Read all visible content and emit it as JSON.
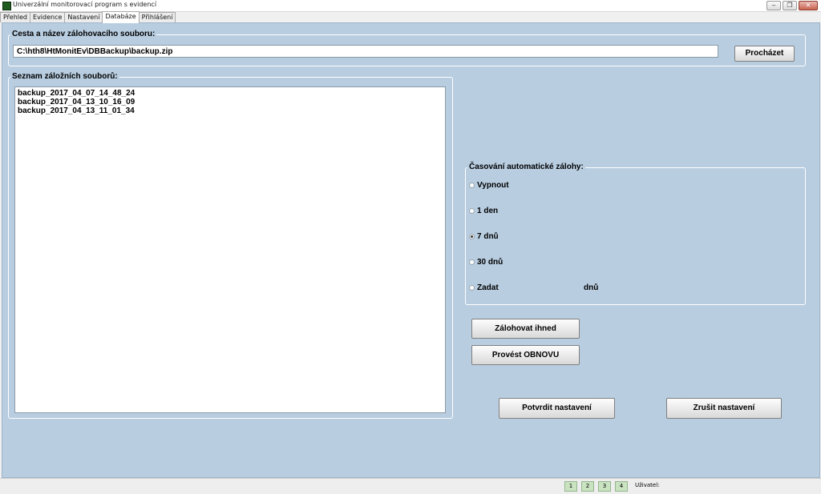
{
  "window": {
    "title": "Univerzální monitorovací program s evidencí",
    "minimize": "‒",
    "maximize": "❐",
    "close": "✕"
  },
  "tabs": [
    {
      "label": "Přehled"
    },
    {
      "label": "Evidence"
    },
    {
      "label": "Nastavení"
    },
    {
      "label": "Databáze"
    },
    {
      "label": "Přihlášení"
    }
  ],
  "backup_path": {
    "label": "Cesta a název zálohovacího souboru:",
    "value": "C:\\hth8\\HtMonitEv\\DBBackup\\backup.zip",
    "browse_label": "Procházet"
  },
  "backup_list": {
    "label": "Seznam záložních souborů:",
    "items": [
      "backup_2017_04_07_14_48_24",
      "backup_2017_04_13_10_16_09",
      "backup_2017_04_13_11_01_34"
    ]
  },
  "auto_backup": {
    "label": "Časování automatické zálohy:",
    "options": [
      {
        "label": "Vypnout",
        "checked": false
      },
      {
        "label": "1 den",
        "checked": false
      },
      {
        "label": "7 dnů",
        "checked": true
      },
      {
        "label": "30 dnů",
        "checked": false
      },
      {
        "label": "Zadat",
        "checked": false
      }
    ],
    "custom_unit": "dnů"
  },
  "actions": {
    "backup_now": "Zálohovat ihned",
    "restore": "Provést OBNOVU",
    "confirm": "Potvrdit nastavení",
    "cancel": "Zrušit nastavení"
  },
  "status": {
    "numbers": [
      "1",
      "2",
      "3",
      "4"
    ],
    "user_label": "Uživatel:"
  }
}
